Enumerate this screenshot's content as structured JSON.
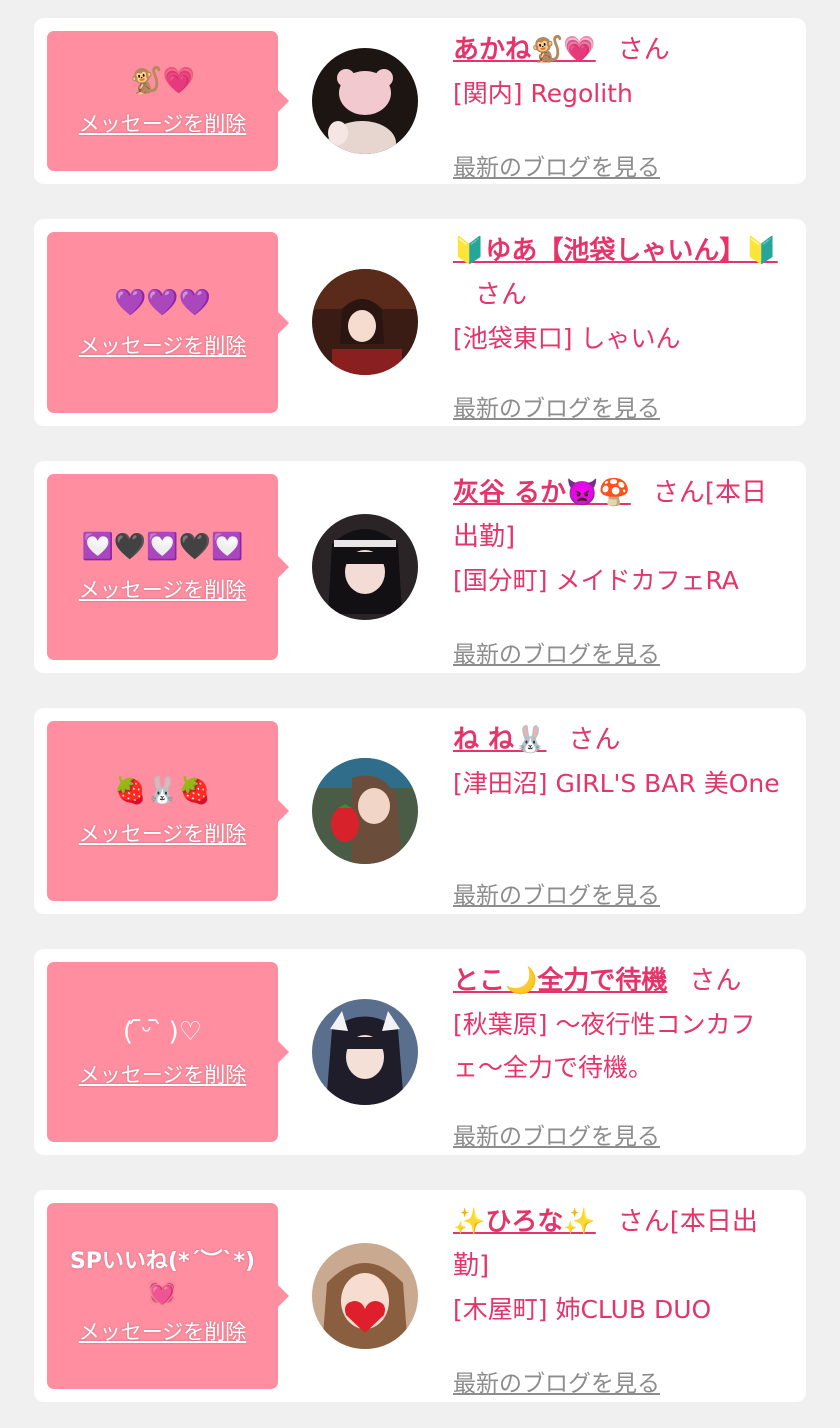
{
  "common": {
    "delete_label": "メッセージを削除",
    "blog_label": "最新のブログを見る",
    "san_label": "さん"
  },
  "colors": {
    "bubble": "#ff8ea0",
    "accent": "#e4346a",
    "muted": "#8d8d8d",
    "background": "#f0f0f0"
  },
  "cards": [
    {
      "message": "🐒💗",
      "name": "あかね🐒💗",
      "badge": "",
      "shop": "[関内] Regolith",
      "avatar_icon": "avatar-photo"
    },
    {
      "message": "💜💜💜",
      "name": "🔰ゆあ【池袋しゃいん】🔰",
      "badge": "",
      "shop": "[池袋東口] しゃいん",
      "avatar_icon": "avatar-photo"
    },
    {
      "message": "💟🖤💟🖤💟",
      "name": "灰谷 るか👿🍄",
      "badge": "[本日出勤]",
      "shop": "[国分町] メイドカフェRA",
      "avatar_icon": "avatar-photo"
    },
    {
      "message": "🍓🐰🍓",
      "name": "ね ね🐰",
      "badge": "",
      "shop": "[津田沼] GIRL'S BAR 美One",
      "avatar_icon": "avatar-photo"
    },
    {
      "message": "( ᷇ᵕ ᷆ )♡",
      "name": "とこ🌙全力で待機",
      "badge": "",
      "shop": "[秋葉原] 〜夜行性コンカフェ〜全力で待機。",
      "avatar_icon": "avatar-photo"
    },
    {
      "message": "SPいいね(*´︶`*)\n💓",
      "name": "✨ひろな✨",
      "badge": "[本日出勤]",
      "shop": "[木屋町] 姉CLUB DUO",
      "avatar_icon": "avatar-photo"
    }
  ]
}
